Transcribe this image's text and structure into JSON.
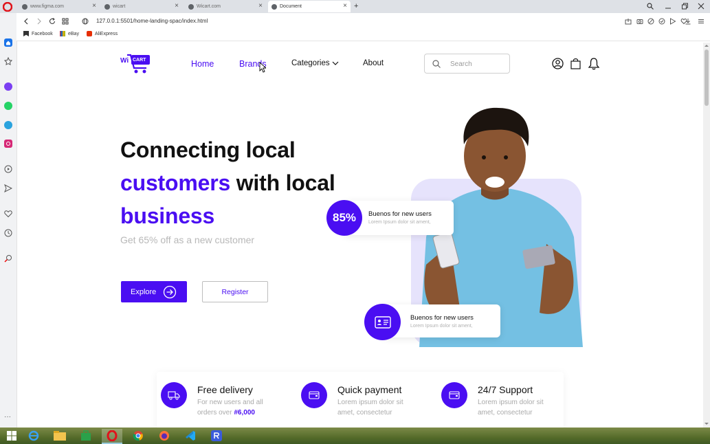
{
  "browser": {
    "tabs": [
      {
        "label": "www.figma.com"
      },
      {
        "label": "wicart"
      },
      {
        "label": "Wicart.com"
      },
      {
        "label": "Document"
      }
    ],
    "new_tab": "+",
    "url": "127.0.0.1:5501/home-landing-spac/index.html",
    "bookmarks": [
      {
        "label": "Facebook"
      },
      {
        "label": "eBay"
      },
      {
        "label": "AliExpress"
      }
    ]
  },
  "header": {
    "logo_wi": "Wi",
    "logo_cart": "CART",
    "nav": [
      {
        "label": "Home"
      },
      {
        "label": "Brands"
      },
      {
        "label": "Categories"
      },
      {
        "label": "About"
      }
    ],
    "search_placeholder": "Search"
  },
  "hero": {
    "line1": "Connecting local",
    "line2_accent": "customers",
    "line2_rest": " with local",
    "line3": "business",
    "subtitle": "Get 65% off as a new customer",
    "explore_label": "Explore",
    "register_label": "Register",
    "badge1_value": "85%",
    "badge1_title": "Buenos for new users",
    "badge1_desc": "Lorem Ipsum dolor sit ament,",
    "badge2_title": "Buenos for new users",
    "badge2_desc": "Lorem Ipsum dolor sit ament,"
  },
  "features": [
    {
      "title": "Free delivery",
      "desc_prefix": "For new users and all orders over ",
      "desc_bold": "#6,000",
      "icon": "truck-icon"
    },
    {
      "title": "Quick payment",
      "desc_prefix": "Lorem ipsum dolor sit amet, consectetur",
      "desc_bold": "",
      "icon": "wallet-icon"
    },
    {
      "title": "24/7 Support",
      "desc_prefix": "Lorem ipsum dolor sit amet, consectetur",
      "desc_bold": "",
      "icon": "wallet-icon"
    }
  ],
  "colors": {
    "accent": "#4a0ef2",
    "hero_blob": "#e6e3fc"
  }
}
